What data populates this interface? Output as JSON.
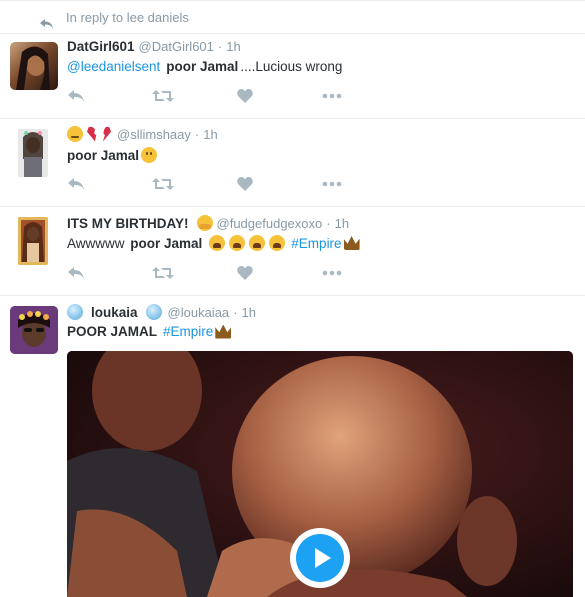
{
  "reply_context": {
    "text": "In reply to lee daniels"
  },
  "tweets": [
    {
      "name": "DatGirl601",
      "handle": "@DatGirl601",
      "time": "1h",
      "mention": "@leedanielsent",
      "bold": "poor Jamal",
      "rest": "....Lucious  wrong"
    },
    {
      "handle": "@sllimshaay",
      "time": "1h",
      "text": "poor Jamal",
      "name_emojis": [
        "sleepy-face-emoji",
        "broken-heart-emoji"
      ],
      "text_emoji": "frowning-face-emoji"
    },
    {
      "name": "ITS MY BIRTHDAY!",
      "handle": "@fudgefudgexoxo",
      "time": "1h",
      "text_plain": "Awwwww ",
      "bold": "poor Jamal",
      "hashtag": "#Empire",
      "name_emoji": "hugging-face-emoji",
      "text_emojis": [
        "weary-face-emoji",
        "weary-face-emoji",
        "weary-face-emoji",
        "weary-face-emoji",
        "crown-emoji"
      ]
    },
    {
      "name": "loukaia",
      "handle": "@loukaiaa",
      "time": "1h",
      "bold": "POOR JAMAL",
      "hashtag": "#Empire",
      "name_emojis": [
        "crystal-ball-emoji",
        "crystal-ball-emoji"
      ],
      "text_emoji": "crown-emoji",
      "media": {
        "type": "video",
        "play_icon": "play-icon"
      }
    }
  ],
  "dot": "·",
  "actions": [
    "reply-icon",
    "retweet-icon",
    "like-icon",
    "more-icon"
  ],
  "colors": {
    "link": "#1b95e0",
    "muted": "#8899a6",
    "text": "#292f33",
    "divider": "#e6ecf0"
  }
}
